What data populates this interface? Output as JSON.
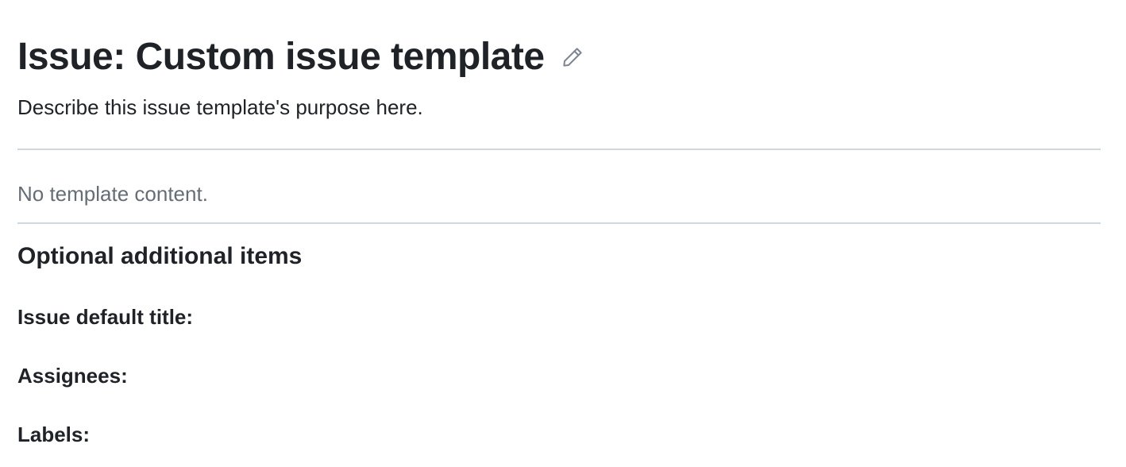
{
  "template": {
    "title": "Issue: Custom issue template",
    "description": "Describe this issue template's purpose here.",
    "empty_content": "No template content.",
    "edit_icon": "pencil-icon"
  },
  "optional_section": {
    "heading": "Optional additional items",
    "fields": {
      "default_title_label": "Issue default title:",
      "assignees_label": "Assignees:",
      "labels_label": "Labels:"
    }
  }
}
